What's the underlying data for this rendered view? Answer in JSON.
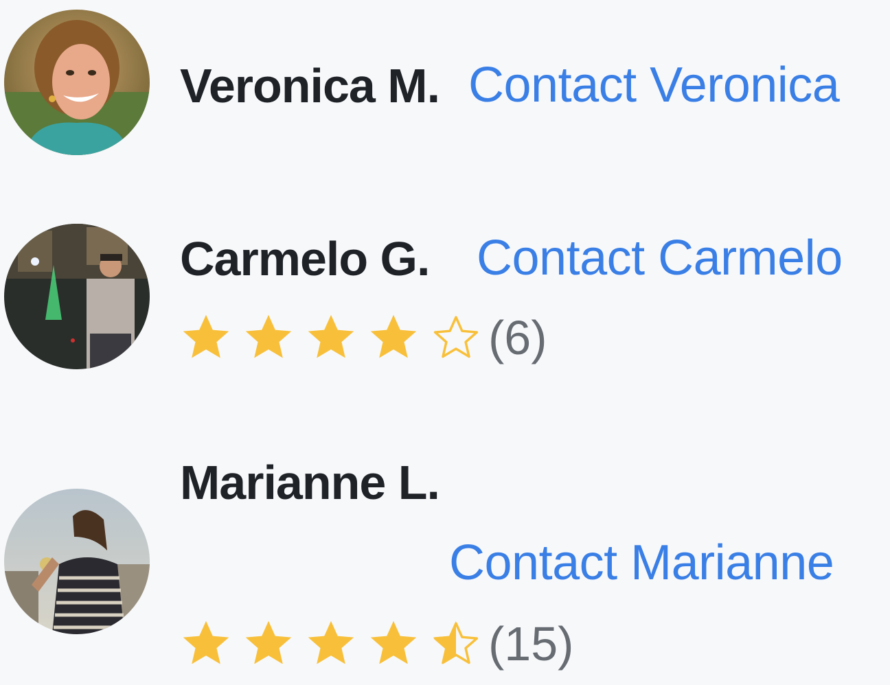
{
  "people": [
    {
      "name": "Veronica M.",
      "contact_label": "Contact Veronica"
    },
    {
      "name": "Carmelo G.",
      "contact_label": "Contact Carmelo",
      "rating": 4,
      "rating_max": 5,
      "review_count": "(6)"
    },
    {
      "name": "Marianne L.",
      "contact_label": "Contact Marianne",
      "rating": 4.5,
      "rating_max": 5,
      "review_count": "(15)"
    }
  ],
  "colors": {
    "star_filled": "#f8c03a",
    "star_empty_stroke": "#f8c03a",
    "link": "#3a7fe6",
    "name": "#1f2328",
    "count": "#676c73",
    "background": "#f7f8fa"
  },
  "icons": {
    "star_filled": "star-filled-icon",
    "star_empty": "star-empty-icon",
    "star_half": "star-half-icon"
  }
}
